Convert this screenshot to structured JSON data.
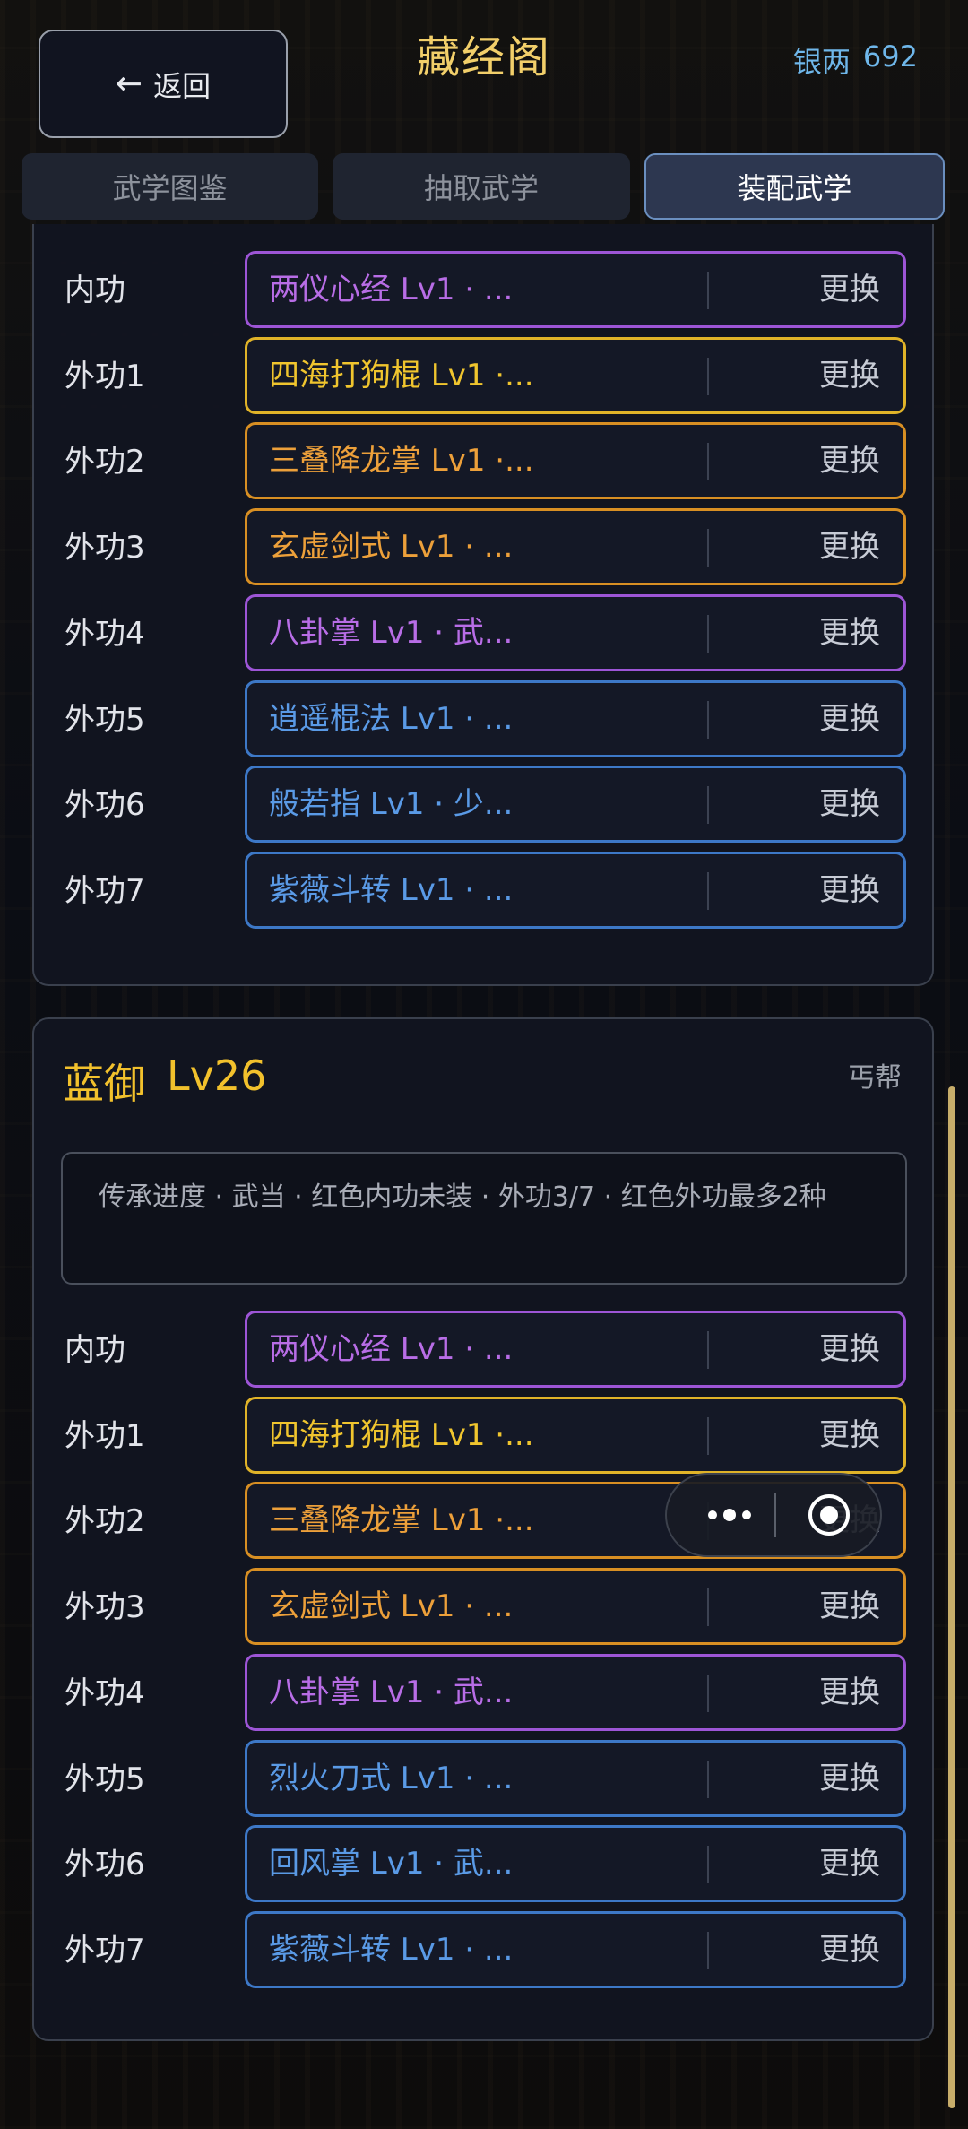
{
  "header": {
    "back_arrow": "←",
    "back_label": "返回",
    "title": "藏经阁",
    "currency_label": "银两",
    "currency_value": "692"
  },
  "tabs": [
    {
      "label": "武学图鉴",
      "active": false
    },
    {
      "label": "抽取武学",
      "active": false
    },
    {
      "label": "装配武学",
      "active": true
    }
  ],
  "swap_label": "更换",
  "colors": {
    "purple": "#9d55d6",
    "gold": "#e0b328",
    "orange": "#d88f23",
    "blue": "#3d78c7"
  },
  "card1": {
    "slots": [
      {
        "label": "内功",
        "skill": "两仪心经  Lv1 · ...",
        "quality": "purple"
      },
      {
        "label": "外功1",
        "skill": "四海打狗棍  Lv1 ·...",
        "quality": "gold"
      },
      {
        "label": "外功2",
        "skill": "三叠降龙掌  Lv1 ·...",
        "quality": "orange"
      },
      {
        "label": "外功3",
        "skill": "玄虚剑式  Lv1 · ...",
        "quality": "orange"
      },
      {
        "label": "外功4",
        "skill": "八卦掌  Lv1 · 武...",
        "quality": "purple"
      },
      {
        "label": "外功5",
        "skill": "逍遥棍法  Lv1 · ...",
        "quality": "blue"
      },
      {
        "label": "外功6",
        "skill": "般若指  Lv1 · 少...",
        "quality": "blue"
      },
      {
        "label": "外功7",
        "skill": "紫薇斗转  Lv1 · ...",
        "quality": "blue"
      }
    ]
  },
  "card2": {
    "name": "蓝御",
    "level": "Lv26",
    "sect": "丐帮",
    "progress_text": "传承进度 · 武当 · 红色内功未装 · 外功3/7 · 红色外功最多2种",
    "slots": [
      {
        "label": "内功",
        "skill": "两仪心经  Lv1 · ...",
        "quality": "purple"
      },
      {
        "label": "外功1",
        "skill": "四海打狗棍  Lv1 ·...",
        "quality": "gold"
      },
      {
        "label": "外功2",
        "skill": "三叠降龙掌  Lv1 ·...",
        "quality": "orange"
      },
      {
        "label": "外功3",
        "skill": "玄虚剑式  Lv1 · ...",
        "quality": "orange"
      },
      {
        "label": "外功4",
        "skill": "八卦掌  Lv1 · 武...",
        "quality": "purple"
      },
      {
        "label": "外功5",
        "skill": "烈火刀式  Lv1 · ...",
        "quality": "blue"
      },
      {
        "label": "外功6",
        "skill": "回风掌  Lv1 · 武...",
        "quality": "blue"
      },
      {
        "label": "外功7",
        "skill": "紫薇斗转  Lv1 · ...",
        "quality": "blue"
      }
    ]
  },
  "capsule": {
    "more_icon": "more-dots-icon",
    "close_icon": "close-target-icon"
  }
}
